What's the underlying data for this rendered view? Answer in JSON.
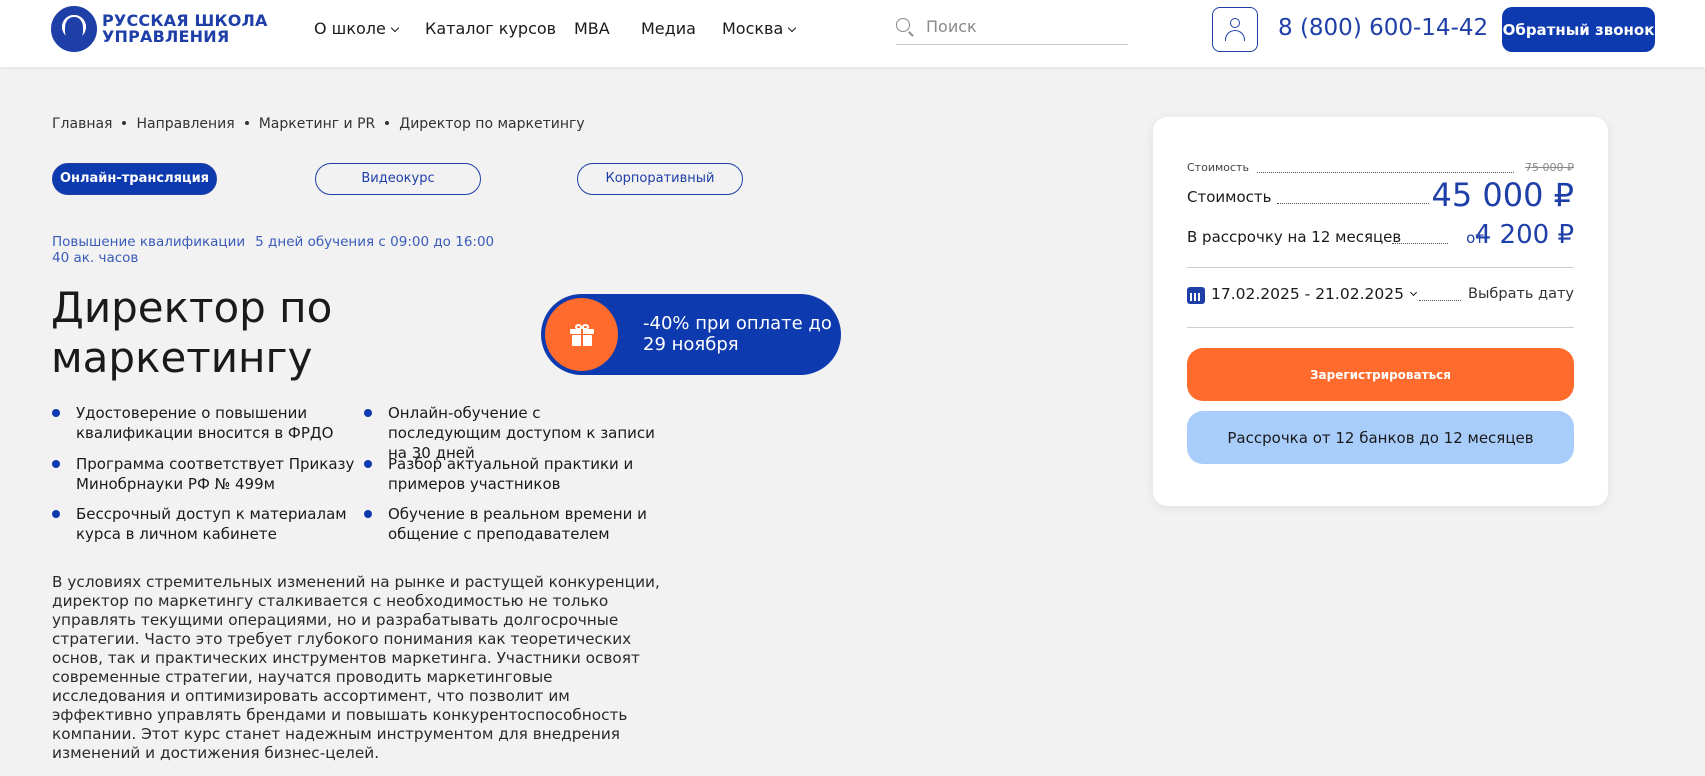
{
  "header": {
    "logo_line1": "РУССКАЯ ШКОЛА",
    "logo_line2": "УПРАВЛЕНИЯ",
    "nav": [
      "О школе",
      "Каталог курсов",
      "MBA",
      "Медиа",
      "Москва"
    ],
    "search_placeholder": "Поиск",
    "phone": "8 (800) 600-14-42",
    "callback_label": "Обратный звонок",
    "brand_color": "#0d3aae"
  },
  "breadcrumbs": [
    "Главная",
    "Направления",
    "Маркетинг и PR",
    "Директор по маркетингу"
  ],
  "tabs": [
    {
      "label": "Онлайн-трансляция",
      "active": true
    },
    {
      "label": "Видеокурс",
      "active": false
    },
    {
      "label": "Корпоративный",
      "active": false
    }
  ],
  "meta": {
    "type": "Повышение квалификации",
    "schedule": "5 дней обучения с 09:00 до 16:00",
    "hours": "40 ак. часов"
  },
  "course": {
    "title_line1": "Директор по",
    "title_line2": "маркетингу"
  },
  "promo": {
    "text": "-40% при оплате до 29 ноября",
    "icon": "gift-icon",
    "accent": "#ff6a2d"
  },
  "features": [
    "Удостоверение о повышении квалификации вносится в ФРДО",
    "Программа соответствует Приказу Минобрнауки РФ № 499м",
    "Бессрочный доступ к материалам курса в личном кабинете",
    "Онлайн-обучение с последующим доступом к записи на 30 дней",
    "Разбор актуальной практики и примеров участников",
    "Обучение в реальном времени и общение с преподавателем"
  ],
  "description": "В условиях стремительных изменений на рынке и растущей конкуренции, директор по маркетингу сталкивается с необходимостью не только управлять текущими операциями, но и разрабатывать долгосрочные стратегии. Часто это требует глубокого понимания как теоретических основ, так и практических инструментов маркетинга. Участники освоят современные стратегии, научатся проводить маркетинговые исследования и оптимизировать ассортимент, что позволит им эффективно управлять брендами и повышать конкурентоспособность компании. Этот курс станет надежным инструментом для внедрения изменений и достижения бизнес-целей.",
  "price_card": {
    "old_label": "Стоимость",
    "old_price": "75 000 ₽",
    "price_label": "Стоимость",
    "price": "45 000 ₽",
    "installment_label": "В рассрочку на 12 месяцев",
    "installment_from": "от",
    "installment_price": "4 200 ₽",
    "date_range": "17.02.2025 - 21.02.2025",
    "pick_date": "Выбрать дату",
    "register_label": "Зарегистрироваться",
    "credit_label": "Рассрочка от 12 банков до 12 месяцев"
  }
}
